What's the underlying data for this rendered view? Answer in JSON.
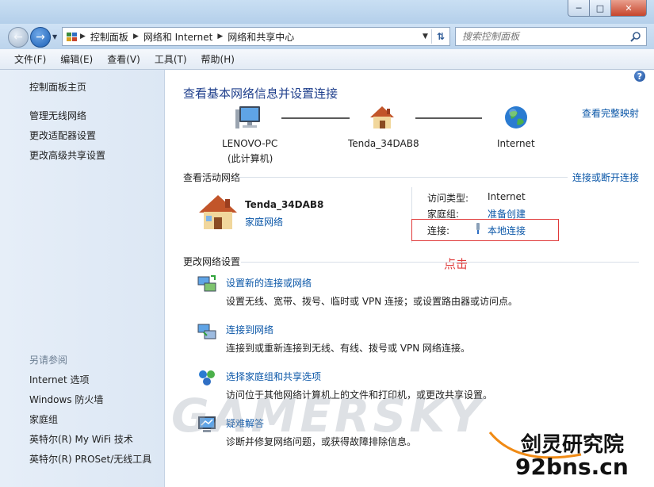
{
  "window": {
    "minimize": "─",
    "maximize": "□",
    "close": "✕"
  },
  "nav": {
    "back_icon": "back-arrow-icon",
    "forward_icon": "forward-arrow-icon",
    "breadcrumb": [
      "控制面板",
      "网络和 Internet",
      "网络和共享中心"
    ],
    "search_placeholder": "搜索控制面板"
  },
  "menu": [
    "文件(F)",
    "编辑(E)",
    "查看(V)",
    "工具(T)",
    "帮助(H)"
  ],
  "sidebar": {
    "home": "控制面板主页",
    "links": [
      "管理无线网络",
      "更改适配器设置",
      "更改高级共享设置"
    ],
    "see_also_title": "另请参阅",
    "see_also": [
      "Internet 选项",
      "Windows 防火墙",
      "家庭组",
      "英特尔(R) My WiFi 技术",
      "英特尔(R) PROSet/无线工具"
    ]
  },
  "main": {
    "title": "查看基本网络信息并设置连接",
    "full_map_link": "查看完整映射",
    "map": {
      "pc_name": "LENOVO-PC",
      "pc_sub": "(此计算机)",
      "router": "Tenda_34DAB8",
      "internet": "Internet"
    },
    "active_title": "查看活动网络",
    "connect_link": "连接或断开连接",
    "network": {
      "name": "Tenda_34DAB8",
      "type_link": "家庭网络",
      "access_label": "访问类型:",
      "access_value": "Internet",
      "homegroup_label": "家庭组:",
      "homegroup_link": "准备创建",
      "connection_label": "连接:",
      "connection_link": "本地连接"
    },
    "annotation": "点击",
    "change_title": "更改网络设置",
    "tasks": [
      {
        "link": "设置新的连接或网络",
        "desc": "设置无线、宽带、拨号、临时或 VPN 连接；或设置路由器或访问点。"
      },
      {
        "link": "连接到网络",
        "desc": "连接到或重新连接到无线、有线、拨号或 VPN 网络连接。"
      },
      {
        "link": "选择家庭组和共享选项",
        "desc": "访问位于其他网络计算机上的文件和打印机，或更改共享设置。"
      },
      {
        "link": "疑难解答",
        "desc": "诊断并修复网络问题，或获得故障排除信息。"
      }
    ]
  },
  "watermark": {
    "text": "GAMERSKY",
    "site_name": "剑灵研究院",
    "site_url": "92bns.cn"
  },
  "colors": {
    "link": "#0b57a8",
    "title": "#1f3f8c",
    "annotation": "#e03a3a"
  }
}
